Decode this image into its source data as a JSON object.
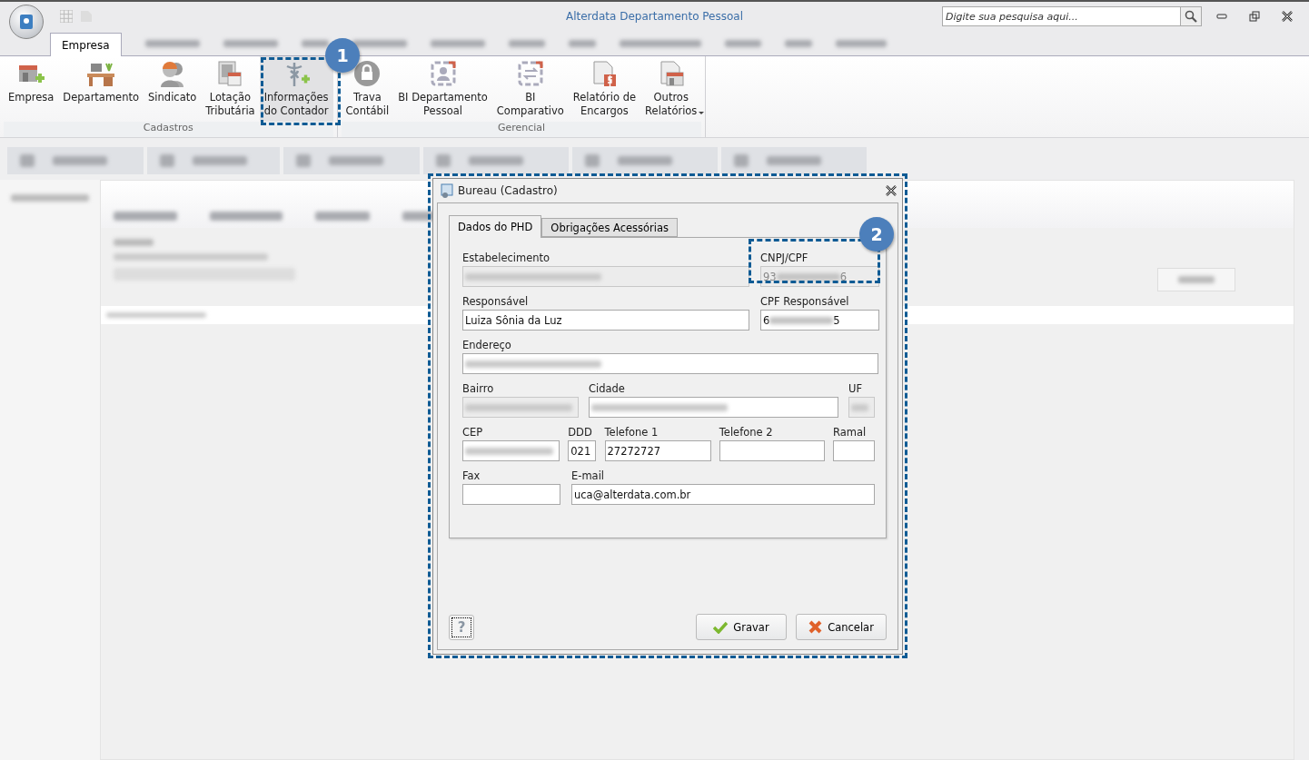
{
  "window": {
    "title": "Alterdata Departamento Pessoal",
    "search": {
      "placeholder": "Digite sua pesquisa aqui..."
    }
  },
  "ribbon_tabs": [
    {
      "label": "Empresa",
      "selected": true
    }
  ],
  "ribbon_groups": [
    {
      "title": "Cadastros",
      "buttons": [
        {
          "label": "Empresa"
        },
        {
          "label": "Departamento"
        },
        {
          "label": "Sindicato"
        },
        {
          "label": "Lotação\nTributária"
        },
        {
          "label": "Informações\ndo Contador",
          "highlighted": true
        }
      ]
    },
    {
      "title": "Gerencial",
      "buttons": [
        {
          "label": "Trava\nContábil"
        },
        {
          "label": "BI Departamento\nPessoal"
        },
        {
          "label": "BI\nComparativo"
        },
        {
          "label": "Relatório de\nEncargos"
        },
        {
          "label": "Outros\nRelatórios",
          "dropdown": true
        }
      ]
    }
  ],
  "dialog": {
    "title": "Bureau (Cadastro)",
    "tabs": [
      {
        "label": "Dados do PHD",
        "selected": true
      },
      {
        "label": "Obrigações Acessórias",
        "selected": false
      }
    ],
    "fields": [
      {
        "label": "Estabelecimento",
        "readonly": true,
        "redacted": true
      },
      {
        "label": "CNPJ/CPF",
        "readonly": true,
        "value_start": "93",
        "value_end": "6"
      },
      {
        "label": "Responsável",
        "value": "Luiza Sônia da Luz"
      },
      {
        "label": "CPF Responsável",
        "value_start": "6",
        "value_end": "5"
      },
      {
        "label": "Endereço",
        "redacted": true
      },
      {
        "label": "Bairro",
        "readonly": true,
        "redacted": true
      },
      {
        "label": "Cidade",
        "redacted": true
      },
      {
        "label": "UF",
        "readonly": true,
        "redacted": true
      },
      {
        "label": "CEP",
        "redacted": true
      },
      {
        "label": "DDD",
        "value": "021"
      },
      {
        "label": "Telefone 1",
        "value": "27272727"
      },
      {
        "label": "Telefone 2"
      },
      {
        "label": "Ramal"
      },
      {
        "label": "Fax"
      },
      {
        "label": "E-mail",
        "value": "uca@alterdata.com.br"
      }
    ],
    "help": "?",
    "buttons": [
      {
        "label": "Gravar",
        "kind": "confirm"
      },
      {
        "label": "Cancelar",
        "kind": "cancel"
      }
    ]
  },
  "callouts": [
    {
      "number": "1"
    },
    {
      "number": "2"
    }
  ]
}
